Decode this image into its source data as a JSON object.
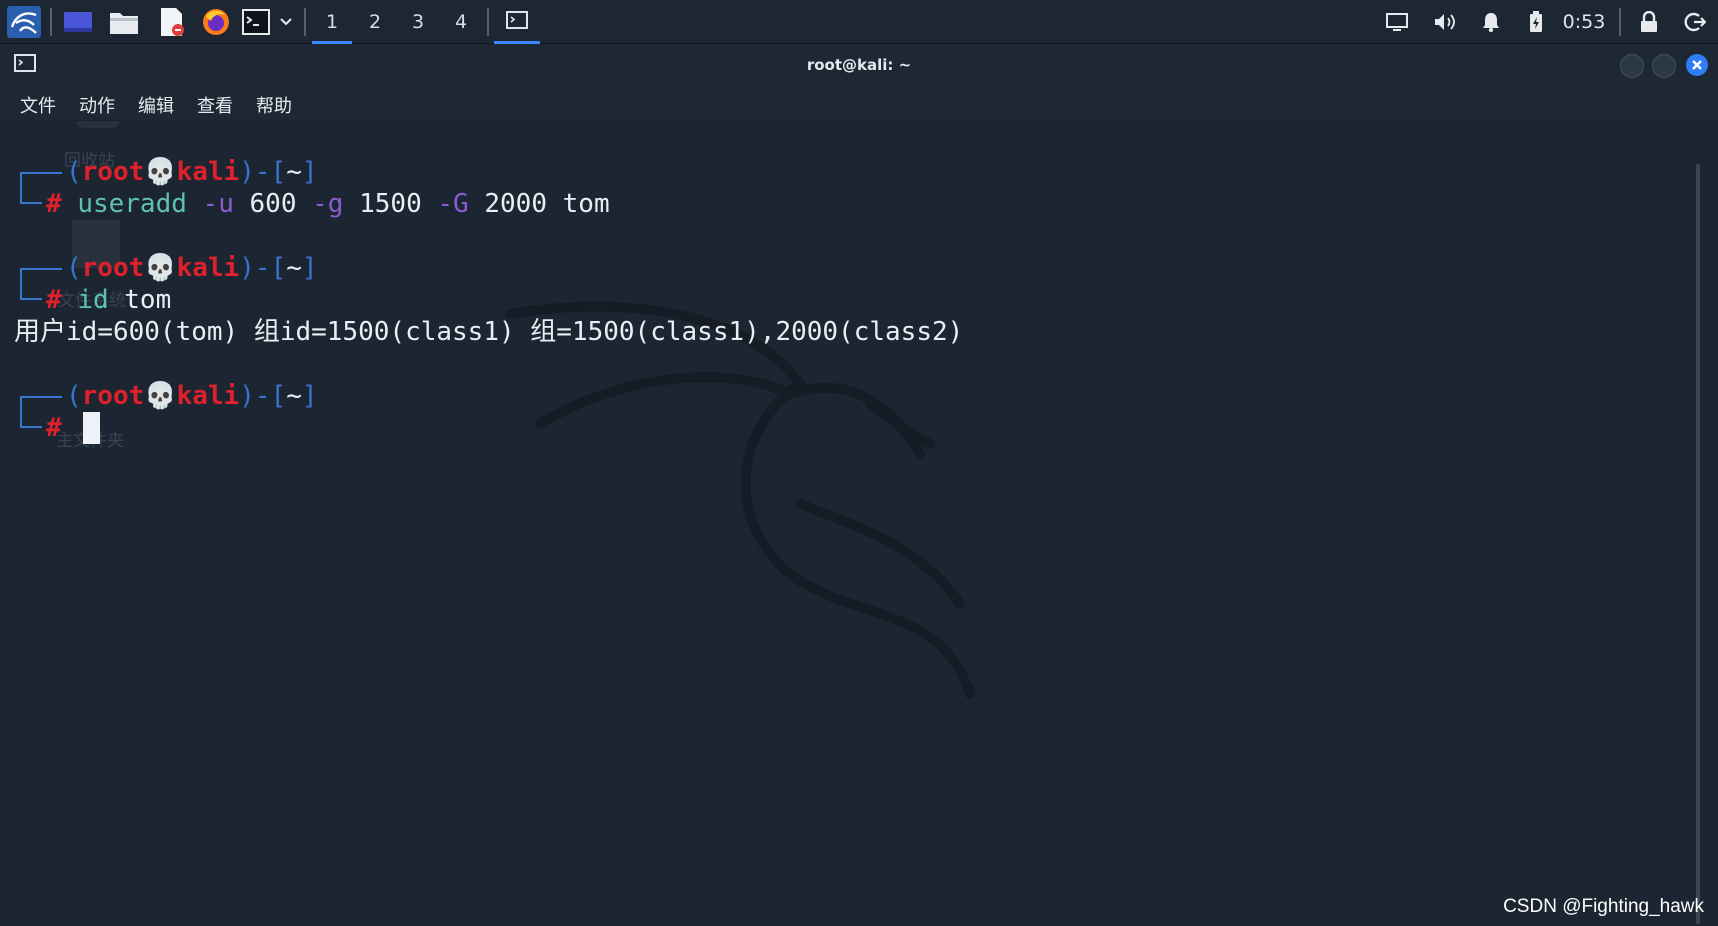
{
  "panel": {
    "workspaces": [
      "1",
      "2",
      "3",
      "4"
    ],
    "active_workspace": "1",
    "clock": "0:53",
    "icons": [
      "kali-menu-icon",
      "desktop-icon",
      "file-manager-icon",
      "text-editor-icon",
      "firefox-icon",
      "terminal-icon",
      "dropdown-chevron-icon",
      "terminal-window-icon",
      "display-icon",
      "volume-icon",
      "notification-bell-icon",
      "battery-icon",
      "lock-icon",
      "logout-icon"
    ],
    "accent": "#3a86ff"
  },
  "window": {
    "title": "root@kali: ~",
    "menu": [
      "文件",
      "动作",
      "编辑",
      "查看",
      "帮助"
    ]
  },
  "desktop_ghosts": [
    "回收站",
    "文件系统",
    "主文件夹"
  ],
  "terminal": {
    "prompt": {
      "open": "(",
      "user": "root",
      "skull": "💀",
      "host": "kali",
      "sep": ")-[",
      "dir": "~",
      "close": "]",
      "hash": "#"
    },
    "cmd1": {
      "name": "useradd",
      "f1": "-u",
      "v1": "600",
      "f2": "-g",
      "v2": "1500",
      "f3": "-G",
      "v3": "2000",
      "arg": "tom"
    },
    "cmd2": {
      "name": "id",
      "arg": "tom"
    },
    "output": "用户id=600(tom) 组id=1500(class1) 组=1500(class1),2000(class2)"
  },
  "colors": {
    "prompt_frame": "#3a74d0",
    "user_host": "#e0202a",
    "command": "#5fc2ae",
    "flag": "#8a5bd0",
    "background": "#1c2632"
  },
  "watermark": "CSDN @Fighting_hawk"
}
